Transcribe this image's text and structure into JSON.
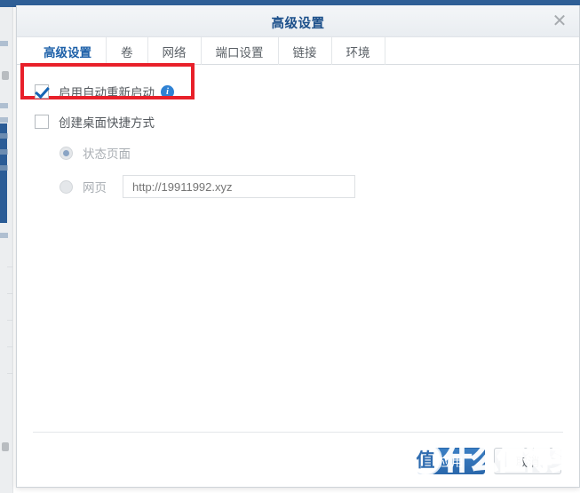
{
  "window": {
    "title": "高级设置",
    "close_icon": "close-icon"
  },
  "tabs": [
    {
      "label": "高级设置",
      "active": true
    },
    {
      "label": "卷",
      "active": false
    },
    {
      "label": "网络",
      "active": false
    },
    {
      "label": "端口设置",
      "active": false
    },
    {
      "label": "链接",
      "active": false
    },
    {
      "label": "环境",
      "active": false
    }
  ],
  "options": {
    "auto_restart": {
      "label": "启用自动重新启动",
      "checked": true,
      "info_icon": "info-icon",
      "highlighted": true
    },
    "desktop_shortcut": {
      "label": "创建桌面快捷方式",
      "checked": false
    }
  },
  "shortcut_target": {
    "status_page": {
      "label": "状态页面",
      "selected": true
    },
    "web_page": {
      "label": "网页",
      "selected": false
    },
    "url_field": {
      "value": "http://19911992.xyz",
      "placeholder": "http://19911992.xyz"
    }
  },
  "footer": {
    "apply_label": "应用",
    "cancel_label": "取消"
  },
  "watermark": {
    "logo": "值",
    "text": "什么值得买"
  },
  "colors": {
    "accent": "#2f5f96",
    "title": "#1b4f8a",
    "tab_active": "#1b5fa8",
    "highlight_box": "#e8202a",
    "primary_button": "#2a68ac",
    "info_icon": "#2f82d4"
  }
}
